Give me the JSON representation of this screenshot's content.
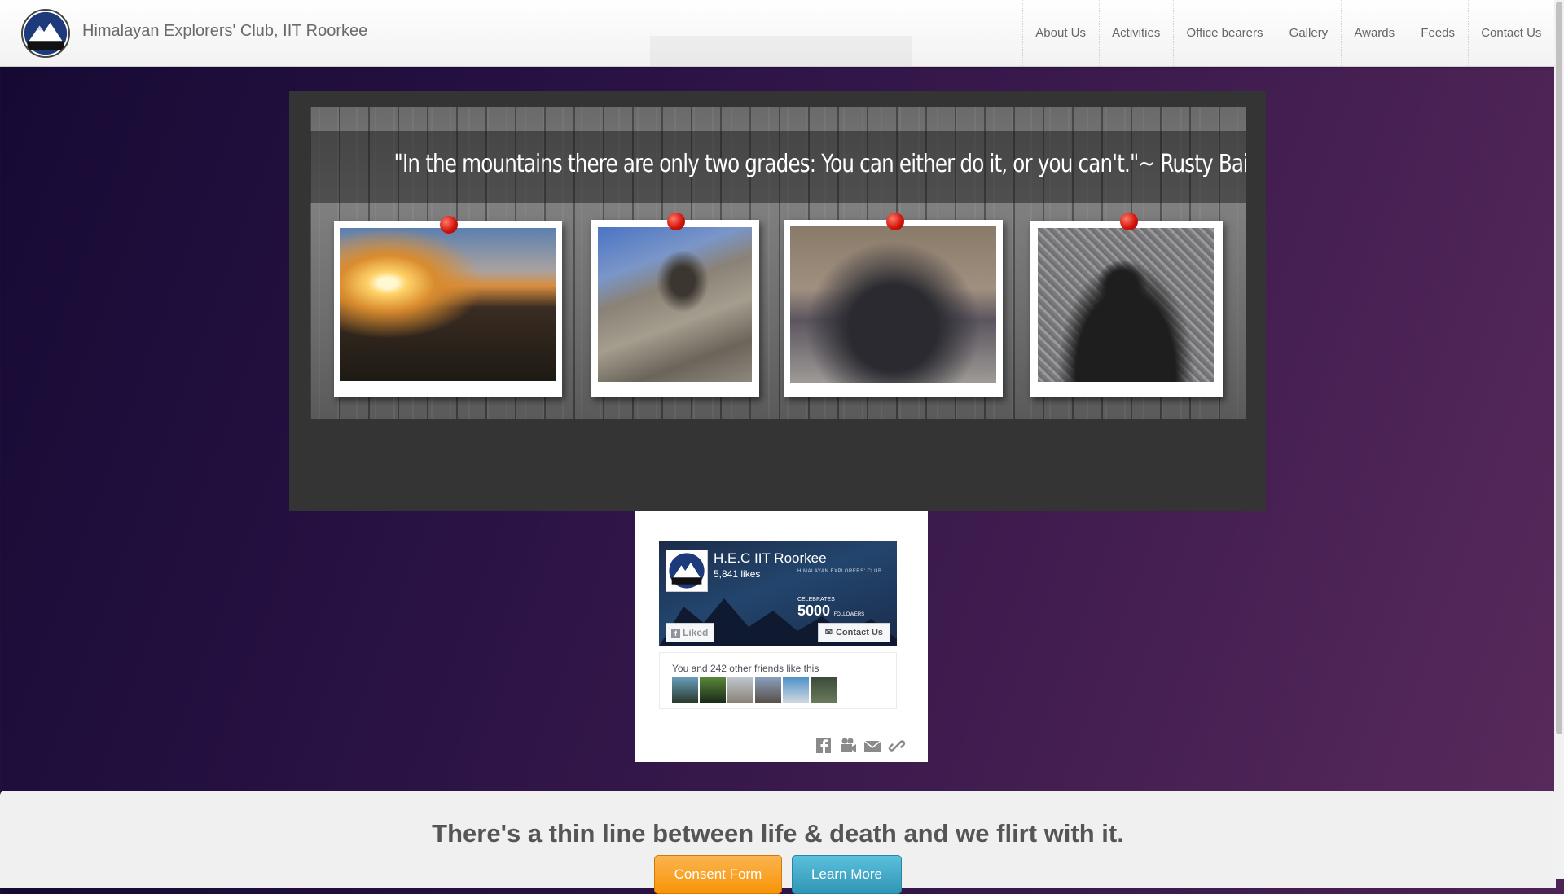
{
  "header": {
    "brand": "Himalayan Explorers' Club, IIT Roorkee",
    "logo_icon": "hec-logo-icon",
    "nav": [
      {
        "label": "About Us"
      },
      {
        "label": "Activities"
      },
      {
        "label": "Office bearers"
      },
      {
        "label": "Gallery"
      },
      {
        "label": "Awards"
      },
      {
        "label": "Feeds"
      },
      {
        "label": "Contact Us"
      }
    ]
  },
  "slider": {
    "quote": "\"In the mountains there are only two grades: You can either do it, or you can't.\"~ Rusty Baille",
    "photos": [
      {
        "name": "sunset-photo"
      },
      {
        "name": "rock-climbing-photo"
      },
      {
        "name": "group-photo"
      },
      {
        "name": "shadow-photo"
      }
    ]
  },
  "facebook": {
    "page_name": "H.E.C IIT Roorkee",
    "likes": "5,841 likes",
    "liked_label": "Liked",
    "contact_label": "Contact Us",
    "friends_text": "You and 242 other friends like this",
    "cover_org": "HIMALAYAN EXPLORERS' CLUB",
    "cover_celebrates": "CELEBRATES",
    "cover_count": "5000",
    "cover_followers": "FOLLOWERS",
    "share_icons": [
      "facebook-icon",
      "video-icon",
      "mail-icon",
      "link-icon"
    ]
  },
  "footer": {
    "tagline": "There's a thin line between life & death and we flirt with it.",
    "consent_label": "Consent Form",
    "learn_label": "Learn More"
  },
  "colors": {
    "background_start": "#150a33",
    "background_end": "#5a2a5c",
    "consent_button": "#f89406",
    "learn_button": "#2f96b4"
  }
}
